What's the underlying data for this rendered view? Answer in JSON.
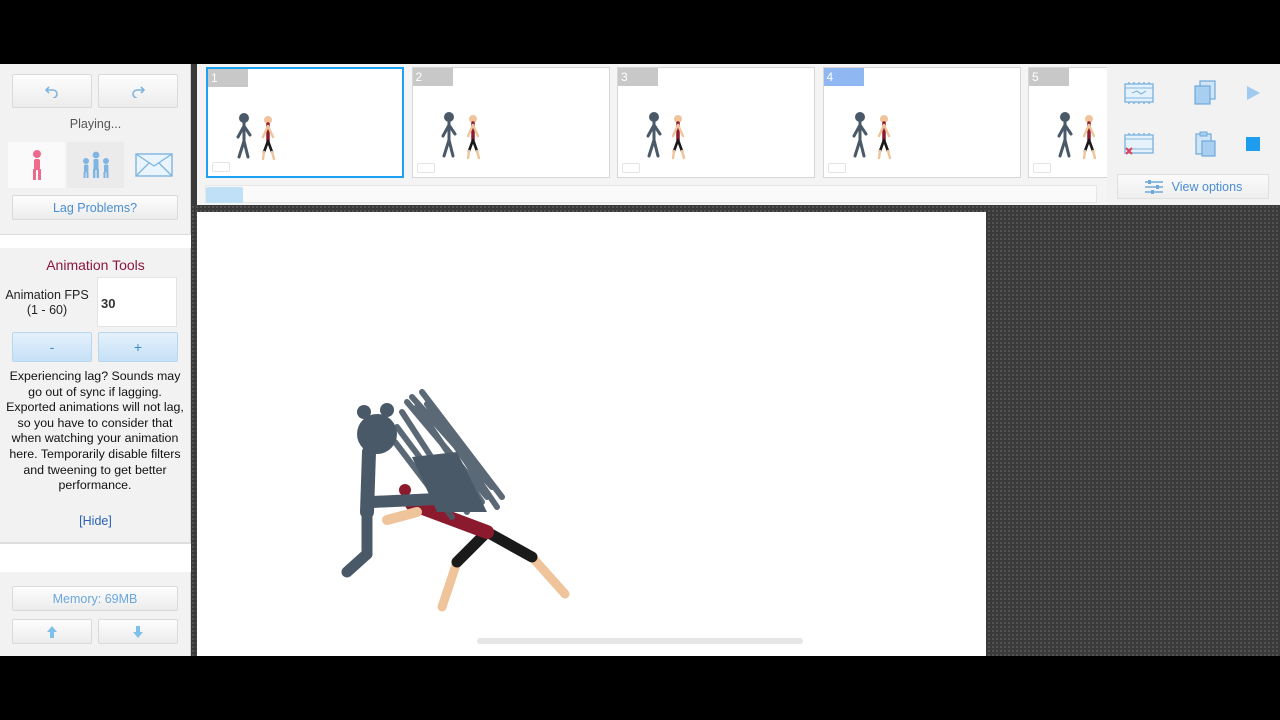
{
  "left_panel": {
    "undo_icon": "undo-arrow-icon",
    "redo_icon": "redo-arrow-icon",
    "status_text": "Playing...",
    "modes": [
      "stickfigure-icon",
      "group-figures-icon",
      "envelope-icon"
    ],
    "lag_button_label": "Lag Problems?",
    "tools_title": "Animation Tools",
    "fps_label_line1": "Animation FPS",
    "fps_label_line2": "(1 - 60)",
    "fps_value": "30",
    "minus_label": "-",
    "plus_label": "+",
    "lag_text": "Experiencing lag? Sounds may go out of sync if lagging. Exported animations will not lag, so you have to consider that when watching your animation here. Temporarily disable filters and tweening to get better performance.",
    "hide_label": "[Hide]",
    "memory_label": "Memory: 69MB",
    "scroll_up_icon": "arrow-up-icon",
    "scroll_down_icon": "arrow-down-icon"
  },
  "timeline": {
    "frames": [
      {
        "number": "1",
        "selected": true
      },
      {
        "number": "2",
        "selected": false
      },
      {
        "number": "3",
        "selected": false
      },
      {
        "number": "4",
        "selected": false,
        "highlight": true
      },
      {
        "number": "5",
        "selected": false
      }
    ]
  },
  "right_toolbar": {
    "icons": [
      "add-frame-icon",
      "copy-icon",
      "play-icon",
      "delete-frame-icon",
      "paste-icon",
      "stop-icon"
    ],
    "view_options_label": "View options"
  },
  "colors": {
    "accent_blue": "#1da1f2",
    "figure_dark": "#4a5968",
    "figure_red": "#8b1a2e",
    "skin": "#f0c49a",
    "title_magenta": "#8b1740"
  }
}
